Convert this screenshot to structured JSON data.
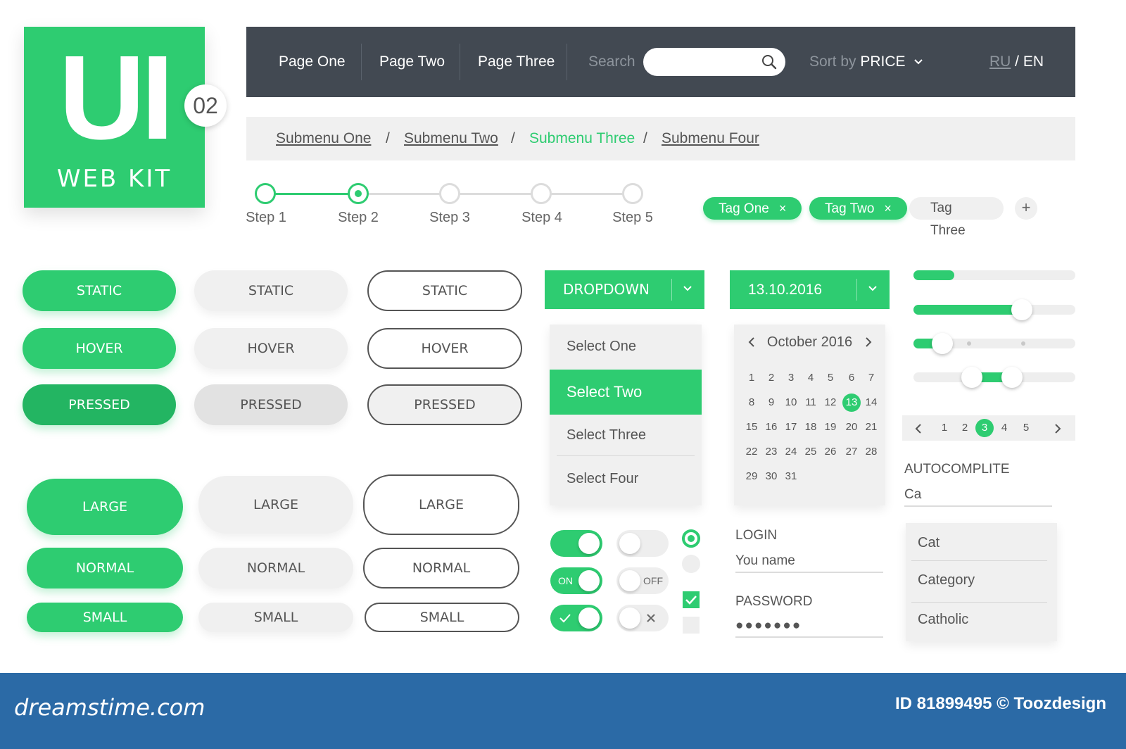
{
  "logo": {
    "title": "UI",
    "subtitle": "WEB KIT",
    "badge": "02"
  },
  "nav": {
    "links": [
      "Page One",
      "Page Two",
      "Page Three"
    ],
    "search_label": "Search",
    "search_value": "",
    "sort_prefix": "Sort by",
    "sort_value": "PRICE",
    "lang_active": "RU",
    "lang_sep": " / ",
    "lang_other": "EN"
  },
  "breadcrumb": {
    "items": [
      "Submenu One",
      "Submenu Two",
      "Submenu Three",
      "Submenu Four"
    ],
    "separator": "/",
    "active_index": 2
  },
  "steps": {
    "labels": [
      "Step 1",
      "Step 2",
      "Step 3",
      "Step 4",
      "Step 5"
    ],
    "current": 2
  },
  "tags": {
    "items": [
      {
        "label": "Tag One",
        "close": "×"
      },
      {
        "label": "Tag Two",
        "close": "×"
      },
      {
        "label": "Tag Three",
        "close": ""
      }
    ],
    "add": "+"
  },
  "buttons": {
    "states": [
      "STATIC",
      "HOVER",
      "PRESSED"
    ],
    "sizes": [
      "LARGE",
      "NORMAL",
      "SMALL"
    ]
  },
  "dropdown": {
    "label": "DROPDOWN",
    "options": [
      "Select One",
      "Select Two",
      "Select Three",
      "Select Four"
    ],
    "selected_index": 1
  },
  "datepicker": {
    "value": "13.10.2016",
    "month": "October 2016",
    "days": [
      "1",
      "2",
      "3",
      "4",
      "5",
      "6",
      "7",
      "8",
      "9",
      "10",
      "11",
      "12",
      "13",
      "14",
      "15",
      "16",
      "17",
      "18",
      "19",
      "20",
      "21",
      "22",
      "23",
      "24",
      "25",
      "26",
      "27",
      "28",
      "29",
      "30",
      "31"
    ],
    "selected_day": "13"
  },
  "sliders": [
    {
      "type": "progress",
      "value": 0.25
    },
    {
      "type": "single",
      "value": 0.67
    },
    {
      "type": "stepped",
      "value": 0.18,
      "steps": 3
    },
    {
      "type": "range",
      "low": 0.36,
      "high": 0.61
    }
  ],
  "pagination": {
    "pages": [
      "1",
      "2",
      "3",
      "4",
      "5"
    ],
    "current": "3"
  },
  "autocomplete": {
    "label": "AUTOCOMPLITE",
    "value": "Ca",
    "suggestions": [
      "Cat",
      "Category",
      "Catholic"
    ]
  },
  "toggles": {
    "on_text": "ON",
    "off_text": "OFF"
  },
  "login": {
    "login_label": "LOGIN",
    "login_value": "You name",
    "password_label": "PASSWORD",
    "password_value": "●●●●●●●"
  },
  "footer": {
    "logo": "dreamstime.com",
    "credit": "ID 81899495 © Toozdesign"
  },
  "colors": {
    "accent": "#2ecc71",
    "nav_bg": "#424952",
    "footer_bg": "#2b6aa6"
  }
}
